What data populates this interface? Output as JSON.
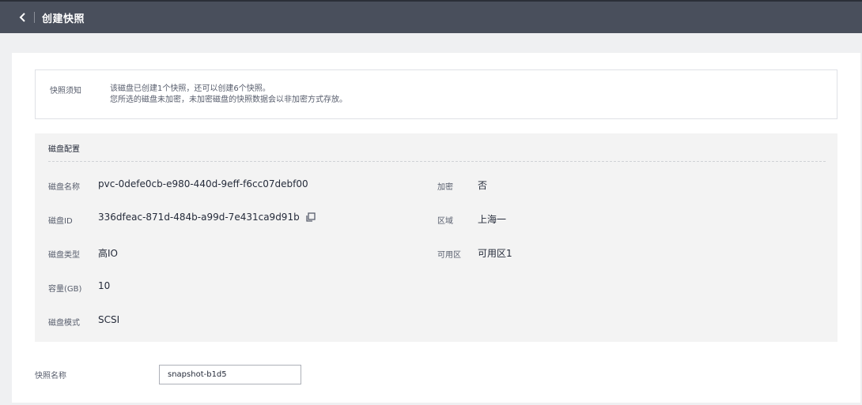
{
  "header": {
    "title": "创建快照",
    "back_icon": "chevron-left-icon"
  },
  "notice": {
    "label": "快照须知",
    "line1": "该磁盘已创建1个快照，还可以创建6个快照。",
    "line2": "您所选的磁盘未加密，未加密磁盘的快照数据会以非加密方式存放。"
  },
  "disk_config": {
    "title": "磁盘配置",
    "name_label": "磁盘名称",
    "name_value": "pvc-0defe0cb-e980-440d-9eff-f6cc07debf00",
    "id_label": "磁盘ID",
    "id_value": "336dfeac-871d-484b-a99d-7e431ca9d91b",
    "type_label": "磁盘类型",
    "type_value": "高IO",
    "capacity_label": "容量(GB)",
    "capacity_value": "10",
    "mode_label": "磁盘模式",
    "mode_value": "SCSI",
    "encrypt_label": "加密",
    "encrypt_value": "否",
    "region_label": "区域",
    "region_value": "上海一",
    "az_label": "可用区",
    "az_value": "可用区1"
  },
  "snapshot": {
    "name_label": "快照名称",
    "name_value": "snapshot-b1d5"
  },
  "colors": {
    "header_bg": "#494f5c",
    "page_bg": "#eff0f2",
    "section_bg": "#f3f3f3"
  }
}
